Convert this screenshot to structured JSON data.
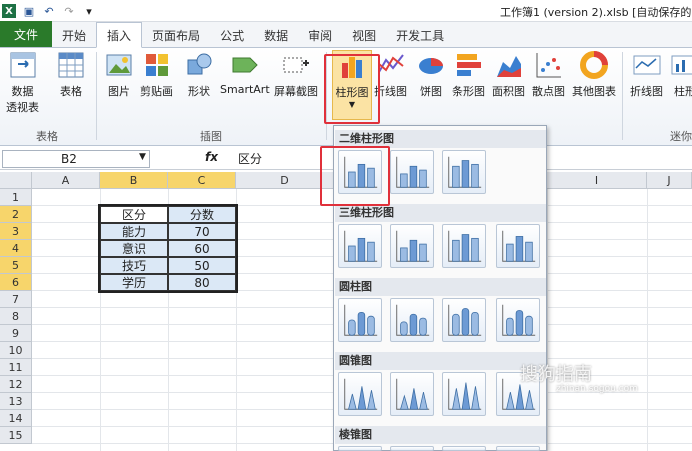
{
  "window": {
    "title": "工作簿1 (version 2).xlsb [自动保存的"
  },
  "tabs": [
    {
      "label": "文件"
    },
    {
      "label": "开始"
    },
    {
      "label": "插入"
    },
    {
      "label": "页面布局"
    },
    {
      "label": "公式"
    },
    {
      "label": "数据"
    },
    {
      "label": "审阅"
    },
    {
      "label": "视图"
    },
    {
      "label": "开发工具"
    }
  ],
  "ribbon": {
    "pivot_label1": "数据",
    "pivot_label2": "透视表",
    "table": "表格",
    "picture": "图片",
    "clipart": "剪贴画",
    "shapes": "形状",
    "smartart": "SmartArt",
    "screenshot": "屏幕截图",
    "column": "柱形图",
    "line": "折线图",
    "pie": "饼图",
    "bar": "条形图",
    "area": "面积图",
    "scatter": "散点图",
    "other": "其他图表",
    "spark_line": "折线图",
    "spark_column": "柱形",
    "group_tables": "表格",
    "group_illus": "插图",
    "group_spark": "迷你"
  },
  "formula_bar": {
    "name_box": "B2",
    "fx": "fx",
    "value": "区分"
  },
  "columns": [
    "A",
    "B",
    "C",
    "D",
    "I",
    "J"
  ],
  "rows": [
    "1",
    "2",
    "3",
    "4",
    "5",
    "6",
    "7",
    "8",
    "9",
    "10",
    "11",
    "12",
    "13",
    "14",
    "15"
  ],
  "table": {
    "header": [
      "区分",
      "分数"
    ],
    "rows": [
      [
        "能力",
        "70"
      ],
      [
        "意识",
        "60"
      ],
      [
        "技巧",
        "50"
      ],
      [
        "学历",
        "80"
      ]
    ]
  },
  "dropdown": {
    "sections": [
      "二维柱形图",
      "三维柱形图",
      "圆柱图",
      "圆锥图",
      "棱锥图"
    ]
  },
  "watermark": {
    "text": "搜狗指南",
    "url": "zhinan.sogou.com"
  }
}
